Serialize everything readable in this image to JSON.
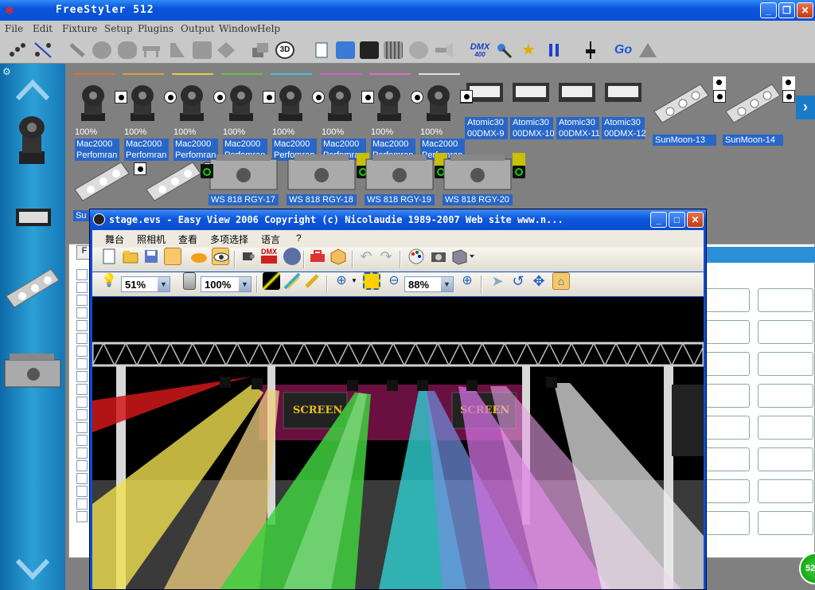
{
  "app": {
    "title": "FreeStyler 512"
  },
  "menu": [
    "File",
    "Edit",
    "Fixture",
    "Setup",
    "Plugins",
    "Output",
    "Window",
    "Help"
  ],
  "toolbar": {
    "dmx_top": "DMX",
    "dmx_sub": "400",
    "go_label": "Go",
    "three_d": "3D"
  },
  "fixtures": {
    "movers": [
      {
        "pct": "100%",
        "line1": "Mac2000",
        "line2": "Perfomran",
        "bar": "#e07030"
      },
      {
        "pct": "100%",
        "line1": "Mac2000",
        "line2": "Perfomran",
        "bar": "#e0a030"
      },
      {
        "pct": "100%",
        "line1": "Mac2000",
        "line2": "Perfomran",
        "bar": "#e0d040"
      },
      {
        "pct": "100%",
        "line1": "Mac2000",
        "line2": "Perfomran",
        "bar": "#70c040"
      },
      {
        "pct": "100%",
        "line1": "Mac2000",
        "line2": "Perfomran",
        "bar": "#40c0e0"
      },
      {
        "pct": "100%",
        "line1": "Mac2000",
        "line2": "Perfomran",
        "bar": "#d060d0"
      },
      {
        "pct": "100%",
        "line1": "Mac2000",
        "line2": "Perfomran",
        "bar": "#e070c0"
      },
      {
        "pct": "100%",
        "line1": "Mac2000",
        "line2": "Perfomran",
        "bar": "#e0e0e0"
      }
    ],
    "strobes": [
      {
        "line1": "Atomic30",
        "line2": "00DMX-9"
      },
      {
        "line1": "Atomic30",
        "line2": "00DMX-10"
      },
      {
        "line1": "Atomic30",
        "line2": "00DMX-11"
      },
      {
        "line1": "Atomic30",
        "line2": "00DMX-12"
      }
    ],
    "sunmoons": [
      "SunMoon-13",
      "SunMoon-14"
    ],
    "lasers": [
      "WS 818 RGY-17",
      "WS 818 RGY-18",
      "WS 818 RGY-19",
      "WS 818 RGY-20"
    ],
    "partial_label": "Su"
  },
  "easyview": {
    "title": "stage.evs - Easy View 2006   Copyright (c) Nicolaudie 1989-2007   Web site www.n...",
    "menu": [
      "舞台",
      "照相机",
      "查看",
      "多项选择",
      "语言",
      "?"
    ],
    "zoom1": "51%",
    "zoom2": "100%",
    "zoom3": "88%",
    "dmx_label": "DMX",
    "screen_label": "SCREEN"
  },
  "status_badge": "52"
}
